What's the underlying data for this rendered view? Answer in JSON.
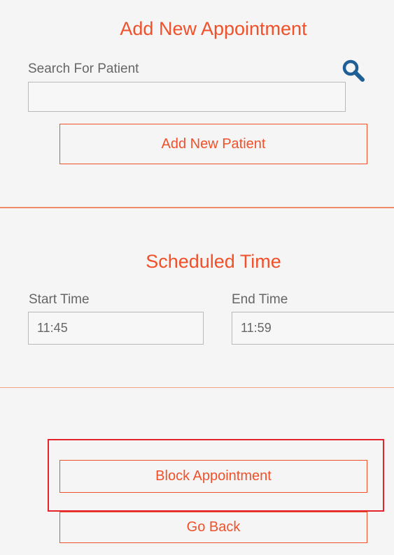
{
  "add_section": {
    "title": "Add New Appointment",
    "search_label": "Search For Patient",
    "search_value": "",
    "search_icon": "search-icon",
    "add_patient_label": "Add New Patient"
  },
  "schedule_section": {
    "title": "Scheduled Time",
    "start_label": "Start Time",
    "start_value": "11:45",
    "end_label": "End Time",
    "end_value": "11:59"
  },
  "actions": {
    "block_label": "Block Appointment",
    "go_back_label": "Go Back"
  },
  "colors": {
    "accent": "#f0502a",
    "highlight": "#e3242f",
    "icon": "#1f5f95",
    "background": "#f5f5f5"
  }
}
